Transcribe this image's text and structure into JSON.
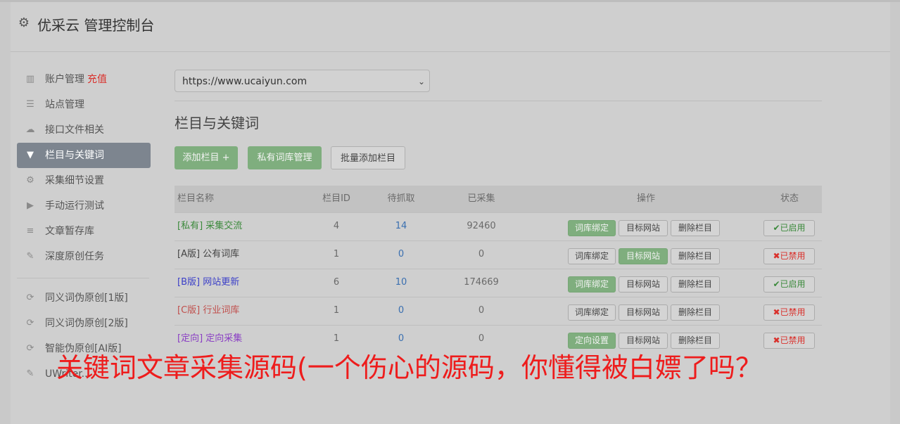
{
  "app": {
    "title": "优采云 管理控制台"
  },
  "sidebar": {
    "items": [
      {
        "label": "账户管理",
        "badge": "充值",
        "icon": "bar-chart-icon"
      },
      {
        "label": "站点管理",
        "icon": "server-icon"
      },
      {
        "label": "接口文件相关",
        "icon": "cloud-upload-icon"
      },
      {
        "label": "栏目与关键词",
        "icon": "filter-icon"
      },
      {
        "label": "采集细节设置",
        "icon": "cogs-icon"
      },
      {
        "label": "手动运行测试",
        "icon": "play-circle-icon"
      },
      {
        "label": "文章暂存库",
        "icon": "database-icon"
      },
      {
        "label": "深度原创任务",
        "icon": "edit-icon"
      }
    ],
    "items2": [
      {
        "label": "同义词伪原创[1版]",
        "icon": "refresh-icon"
      },
      {
        "label": "同义词伪原创[2版]",
        "icon": "refresh-icon"
      },
      {
        "label": "智能伪原创[AI版]",
        "icon": "refresh-icon"
      },
      {
        "label": "UWriter...",
        "icon": "edit-icon"
      }
    ]
  },
  "main": {
    "site_select": {
      "value": "https://www.ucaiyun.com"
    },
    "section_title": "栏目与关键词",
    "buttons": {
      "add_column": "添加栏目 +",
      "private_lib": "私有词库管理",
      "batch_add": "批量添加栏目"
    },
    "table": {
      "headers": {
        "name": "栏目名称",
        "id": "栏目ID",
        "pending": "待抓取",
        "collected": "已采集",
        "ops": "操作",
        "status": "状态"
      },
      "rows": [
        {
          "name": "[私有] 采集交流",
          "id": "4",
          "pending": "14",
          "collected": "92460",
          "op1": "词库绑定",
          "op2": "目标网站",
          "op3": "删除栏目",
          "status": "已启用"
        },
        {
          "name": "[A版] 公有词库",
          "id": "1",
          "pending": "0",
          "collected": "0",
          "op1": "词库绑定",
          "op2": "目标网站",
          "op3": "删除栏目",
          "status": "已禁用"
        },
        {
          "name": "[B版] 网站更新",
          "id": "6",
          "pending": "10",
          "collected": "174669",
          "op1": "词库绑定",
          "op2": "目标网站",
          "op3": "删除栏目",
          "status": "已启用"
        },
        {
          "name": "[C版] 行业词库",
          "id": "1",
          "pending": "0",
          "collected": "0",
          "op1": "词库绑定",
          "op2": "目标网站",
          "op3": "删除栏目",
          "status": "已禁用"
        },
        {
          "name": "[定向] 定向采集",
          "id": "1",
          "pending": "0",
          "collected": "0",
          "op1": "定向设置",
          "op2": "目标网站",
          "op3": "删除栏目",
          "status": "已禁用"
        }
      ]
    }
  },
  "overlay_text": "关键词文章采集源码(一个伤心的源码，你懂得被白嫖了吗？",
  "colors": {
    "accent_green": "#7fae7e",
    "danger_red": "#d9302b",
    "active_nav": "#7d858f",
    "overlay_red": "#ee1c1c"
  }
}
